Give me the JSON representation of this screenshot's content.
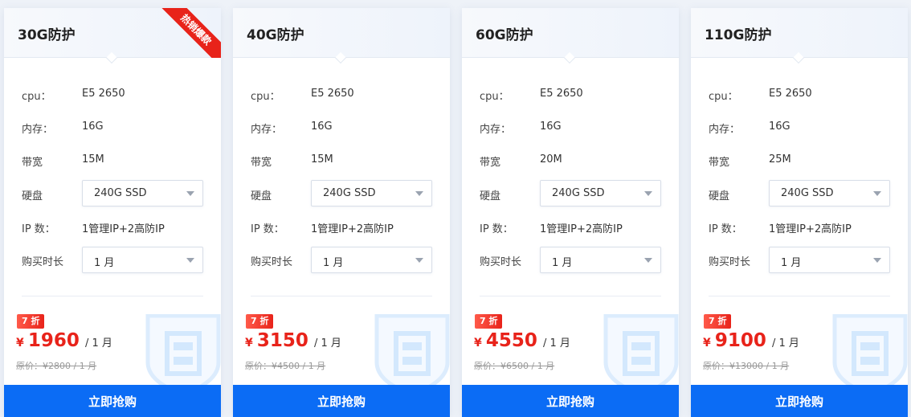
{
  "colors": {
    "accent": "#0b6cf5",
    "price": "#e8231a",
    "ribbon": "#e8231a"
  },
  "plans": [
    {
      "title": "30G防护",
      "ribbon": "热销爆款",
      "specs": {
        "cpu_label": "cpu：",
        "cpu_value": "E5 2650",
        "mem_label": "内存：",
        "mem_value": "16G",
        "bw_label": "带宽",
        "bw_value": "15M",
        "disk_label": "硬盘",
        "disk_value": "240G SSD",
        "ip_label": "IP 数：",
        "ip_value": "1管理IP+2高防IP",
        "term_label": "购买时长",
        "term_value": "1 月"
      },
      "discount": "7 折",
      "currency": "¥",
      "price": "1960",
      "per": "/ 1 月",
      "original": "原价：¥2800 / 1 月",
      "buy_label": "立即抢购"
    },
    {
      "title": "40G防护",
      "ribbon": "",
      "specs": {
        "cpu_label": "cpu：",
        "cpu_value": "E5 2650",
        "mem_label": "内存：",
        "mem_value": "16G",
        "bw_label": "带宽",
        "bw_value": "15M",
        "disk_label": "硬盘",
        "disk_value": "240G SSD",
        "ip_label": "IP 数：",
        "ip_value": "1管理IP+2高防IP",
        "term_label": "购买时长",
        "term_value": "1 月"
      },
      "discount": "7 折",
      "currency": "¥",
      "price": "3150",
      "per": "/ 1 月",
      "original": "原价：¥4500 / 1 月",
      "buy_label": "立即抢购"
    },
    {
      "title": "60G防护",
      "ribbon": "",
      "specs": {
        "cpu_label": "cpu：",
        "cpu_value": "E5 2650",
        "mem_label": "内存：",
        "mem_value": "16G",
        "bw_label": "带宽",
        "bw_value": "20M",
        "disk_label": "硬盘",
        "disk_value": "240G SSD",
        "ip_label": "IP 数：",
        "ip_value": "1管理IP+2高防IP",
        "term_label": "购买时长",
        "term_value": "1 月"
      },
      "discount": "7 折",
      "currency": "¥",
      "price": "4550",
      "per": "/ 1 月",
      "original": "原价：¥6500 / 1 月",
      "buy_label": "立即抢购"
    },
    {
      "title": "110G防护",
      "ribbon": "",
      "specs": {
        "cpu_label": "cpu：",
        "cpu_value": "E5 2650",
        "mem_label": "内存：",
        "mem_value": "16G",
        "bw_label": "带宽",
        "bw_value": "25M",
        "disk_label": "硬盘",
        "disk_value": "240G SSD",
        "ip_label": "IP 数：",
        "ip_value": "1管理IP+2高防IP",
        "term_label": "购买时长",
        "term_value": "1 月"
      },
      "discount": "7 折",
      "currency": "¥",
      "price": "9100",
      "per": "/ 1 月",
      "original": "原价：¥13000 / 1 月",
      "buy_label": "立即抢购"
    }
  ]
}
